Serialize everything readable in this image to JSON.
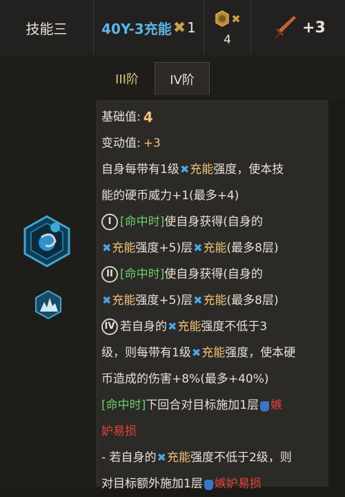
{
  "header": {
    "title": "技能三",
    "charge_label": "40Y-3充能",
    "charge_x": "✖",
    "charge_count": "1",
    "coin_x": "✖",
    "coin_count": "4",
    "sword_bonus": "+3"
  },
  "tabs": [
    {
      "label": "III阶",
      "active": false
    },
    {
      "label": "IV阶",
      "active": true
    }
  ],
  "content": {
    "base_label": "基础值:",
    "base_value": "4",
    "change_label": "变动值:",
    "change_value": "+3",
    "d1a": "自身每带有1级",
    "charge_word": "充能",
    "d1b": "强度，使本技",
    "d2": "能的硬币威力+1(最多+4)",
    "r1": "I",
    "hit": "[命中时]",
    "e1a": "使自身获得(自身的",
    "e1b": "强度+5)层",
    "e1c": "(最多8层)",
    "r2": "II",
    "r4": "IV",
    "e3a": "若自身的",
    "e3b": "强度不低于3",
    "e3c": "级，则每带有1级",
    "e3d": "强度，使本硬",
    "e3e": "币造成的伤害+8%(最多+40%)",
    "e4a": "下回合对目标施加1层",
    "e4b": "嫉",
    "e4c": "妒易损",
    "e5a": "- 若自身的",
    "e5b": "强度不低于2级，则",
    "e5c": "对目标额外施加1层",
    "e5d": "嫉妒易损"
  },
  "colors": {
    "charge_blue": "#5cb5e6",
    "highlight": "#f0c27b",
    "hit_green": "#6bd06b",
    "envy_red": "#e0433b"
  },
  "icons": [
    "skill-emblem-icon",
    "crystal-icon",
    "coin-icon",
    "sword-icon",
    "charge-icon",
    "envy-jar-icon"
  ]
}
